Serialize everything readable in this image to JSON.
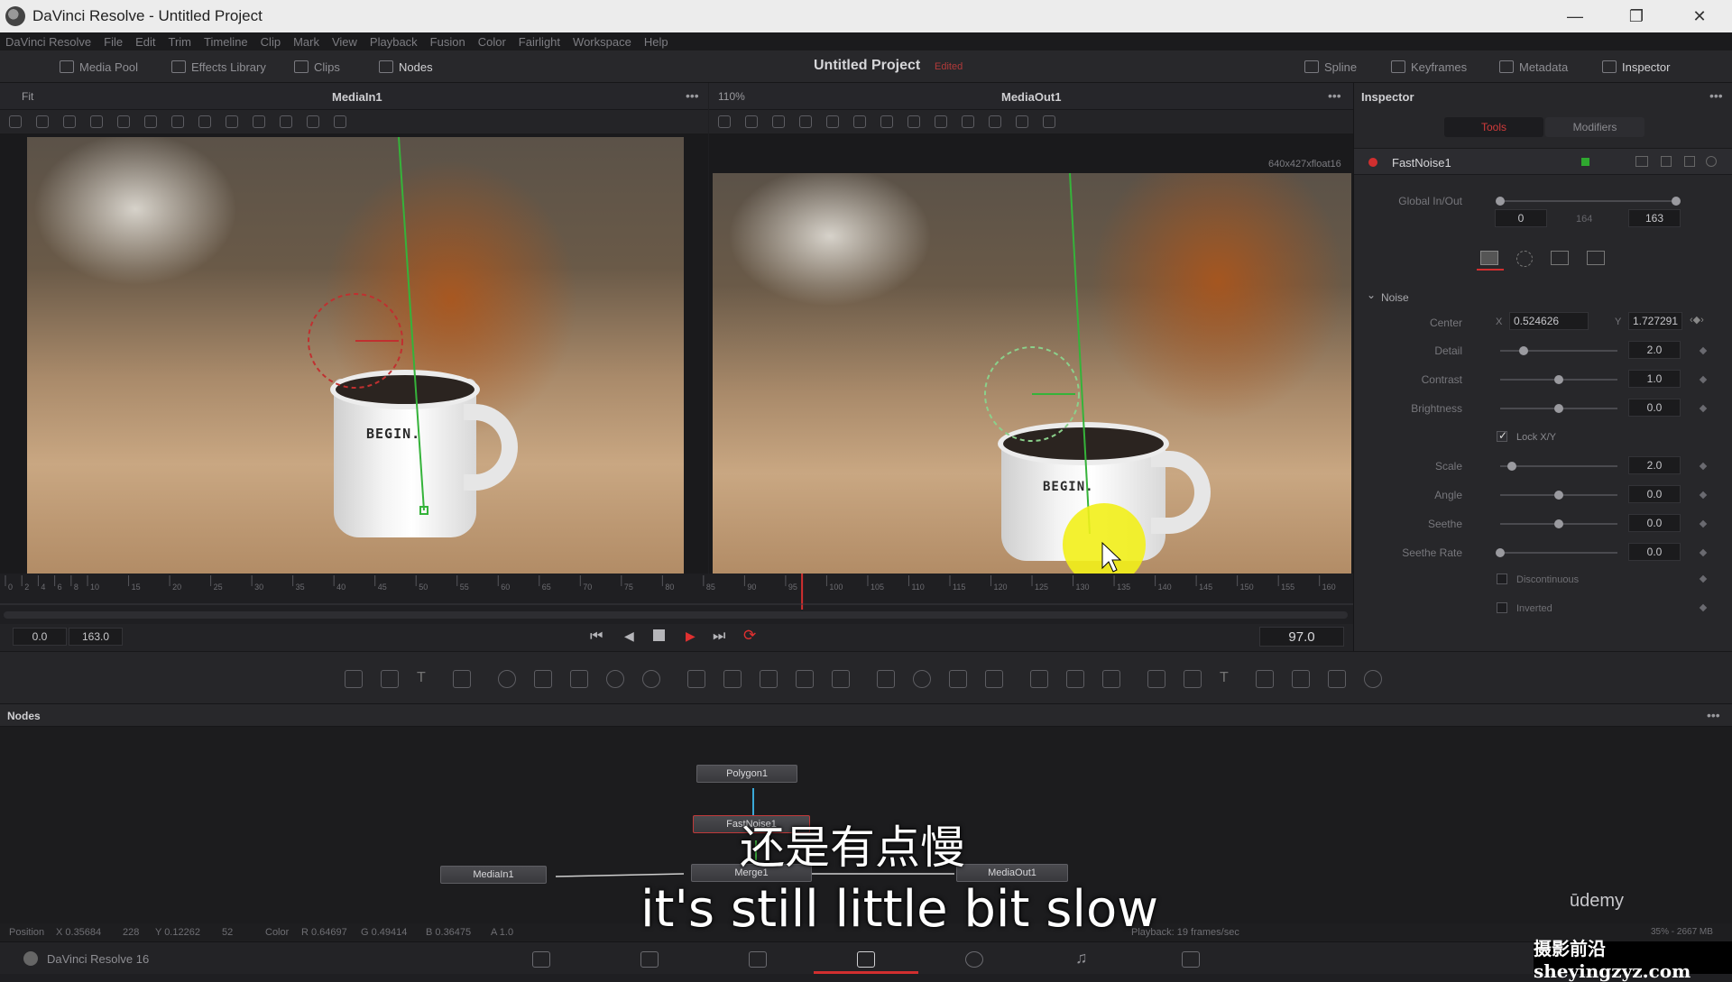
{
  "window": {
    "title": "DaVinci Resolve - Untitled Project",
    "minimize": "—",
    "restore": "❐",
    "close": "✕"
  },
  "menu": [
    "DaVinci Resolve",
    "File",
    "Edit",
    "Trim",
    "Timeline",
    "Clip",
    "Mark",
    "View",
    "Playback",
    "Fusion",
    "Color",
    "Fairlight",
    "Workspace",
    "Help"
  ],
  "toolbar": {
    "media_pool": "Media Pool",
    "effects_library": "Effects Library",
    "clips": "Clips",
    "nodes": "Nodes",
    "project_title": "Untitled Project",
    "edited": "Edited",
    "spline": "Spline",
    "keyframes": "Keyframes",
    "metadata": "Metadata",
    "inspector": "Inspector"
  },
  "viewer_left": {
    "name": "MediaIn1",
    "fit": "Fit",
    "label": "BEGIN."
  },
  "viewer_right": {
    "name": "MediaOut1",
    "zoom": "110%",
    "resolution": "640x427xfloat16",
    "label": "BEGIN."
  },
  "inspector": {
    "header": "Inspector",
    "tabs": [
      "Tools",
      "Modifiers"
    ],
    "tool_name": "FastNoise1",
    "global_label": "Global In/Out",
    "global_in": "0",
    "global_mid": "164",
    "global_out": "163",
    "section": "Noise",
    "center_label": "Center",
    "center_x_label": "X",
    "center_x": "0.524626",
    "center_y_label": "Y",
    "center_y": "1.727291",
    "rows": [
      {
        "label": "Detail",
        "value": "2.0",
        "pos": 0.2
      },
      {
        "label": "Contrast",
        "value": "1.0",
        "pos": 0.5
      },
      {
        "label": "Brightness",
        "value": "0.0",
        "pos": 0.5
      }
    ],
    "lock_xy": "Lock X/Y",
    "rows2": [
      {
        "label": "Scale",
        "value": "2.0",
        "pos": 0.1
      },
      {
        "label": "Angle",
        "value": "0.0",
        "pos": 0.5
      },
      {
        "label": "Seethe",
        "value": "0.0",
        "pos": 0.5
      },
      {
        "label": "Seethe Rate",
        "value": "0.0",
        "pos": 0.0
      }
    ],
    "discontinuous": "Discontinuous",
    "inverted": "Inverted"
  },
  "timeline": {
    "ticks": [
      "0",
      "2",
      "4",
      "6",
      "8",
      "10",
      "15",
      "20",
      "25",
      "30",
      "35",
      "40",
      "45",
      "50",
      "55",
      "60",
      "65",
      "70",
      "75",
      "80",
      "85",
      "90",
      "95",
      "100",
      "105",
      "110",
      "115",
      "120",
      "125",
      "130",
      "135",
      "140",
      "145",
      "150",
      "155",
      "160"
    ],
    "start": "0.0",
    "end": "163.0",
    "current": "97.0"
  },
  "nodes_panel": {
    "header": "Nodes",
    "nodes": [
      "Polygon1",
      "FastNoise1",
      "MediaIn1",
      "Merge1",
      "MediaOut1"
    ]
  },
  "status": {
    "position": "Position",
    "x": "X 0.35684",
    "x2": "228",
    "y": "Y 0.12262",
    "y2": "52",
    "color": "Color",
    "r": "R 0.64697",
    "g": "G 0.49414",
    "b": "B 0.36475",
    "a": "A 1.0",
    "playback": "Playback: 19 frames/sec",
    "memory": "35% - 2667 MB"
  },
  "pagebar": {
    "version": "DaVinci Resolve 16"
  },
  "overlay": {
    "subtitle_cn": "还是有点慢",
    "subtitle_en": "it's still little bit slow",
    "udemy": "ūdemy",
    "watermark": "摄影前沿 sheyingzyz.com"
  },
  "colors": {
    "accent_red": "#d12f2f",
    "cursor_highlight": "#f2ef1a",
    "green_line": "#35b33a"
  }
}
